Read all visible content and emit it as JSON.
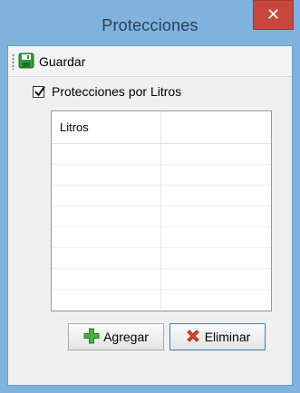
{
  "window": {
    "title": "Protecciones",
    "close_glyph": "✕"
  },
  "toolbar": {
    "save_label": "Guardar",
    "save_icon": "floppy-disk-icon"
  },
  "options": {
    "protecciones_litros_label": "Protecciones por Litros",
    "protecciones_litros_checked": true
  },
  "grid": {
    "columns": [
      "Litros",
      ""
    ],
    "rows": [
      [
        "",
        ""
      ],
      [
        "",
        ""
      ],
      [
        "",
        ""
      ],
      [
        "",
        ""
      ],
      [
        "",
        ""
      ],
      [
        "",
        ""
      ],
      [
        "",
        ""
      ],
      [
        "",
        ""
      ]
    ]
  },
  "buttons": {
    "add_label": "Agregar",
    "add_icon": "plus-icon",
    "delete_label": "Eliminar",
    "delete_icon": "x-icon"
  },
  "colors": {
    "title_bar": "#7fb2dd",
    "close_button": "#c8473c",
    "client_bg": "#f0f0f0"
  }
}
